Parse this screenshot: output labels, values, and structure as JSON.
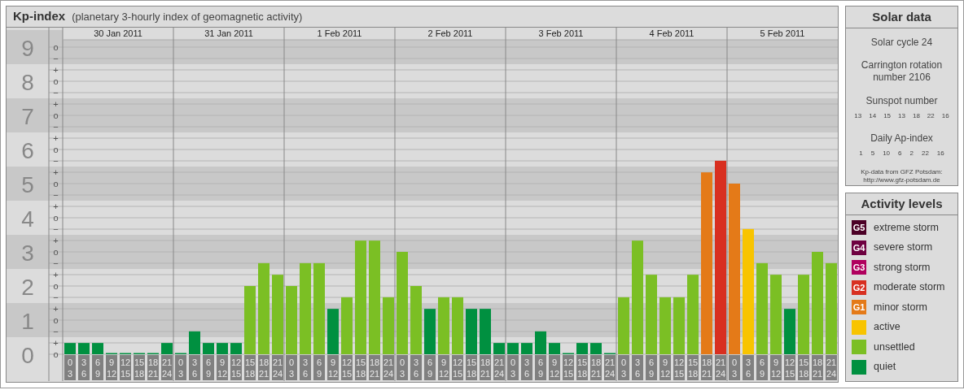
{
  "kp_panel": {
    "title": "Kp-index",
    "subtitle": "(planetary 3-hourly index of geomagnetic activity)",
    "days": [
      "30 Jan 2011",
      "31 Jan 2011",
      "1 Feb 2011",
      "2 Feb 2011",
      "3 Feb 2011",
      "4 Feb 2011",
      "5 Feb 2011"
    ],
    "sublabels": [
      "o",
      "−",
      "+",
      "o",
      "−",
      "+",
      "o",
      "−",
      "+",
      "o",
      "−",
      "+",
      "o",
      "−",
      "+",
      "o",
      "−",
      "+",
      "o",
      "−",
      "+",
      "o",
      "−",
      "+",
      "o",
      "−",
      "+",
      "o"
    ],
    "chart_data": {
      "type": "bar",
      "grid": true,
      "ylim": [
        0,
        9
      ],
      "yticks": [
        0,
        1,
        2,
        3,
        4,
        5,
        6,
        7,
        8,
        9
      ],
      "categories": [
        "0\n3",
        "3\n6",
        "6\n9",
        "9\n12",
        "12\n15",
        "15\n18",
        "18\n21",
        "21\n24",
        "0\n3",
        "3\n6",
        "6\n9",
        "9\n12",
        "12\n15",
        "15\n18",
        "18\n21",
        "21\n24",
        "0\n3",
        "3\n6",
        "6\n9",
        "9\n12",
        "12\n15",
        "15\n18",
        "18\n21",
        "21\n24",
        "0\n3",
        "3\n6",
        "6\n9",
        "9\n12",
        "12\n15",
        "15\n18",
        "18\n21",
        "21\n24",
        "0\n3",
        "3\n6",
        "6\n9",
        "9\n12",
        "12\n15",
        "15\n18",
        "18\n21",
        "21\n24",
        "0\n3",
        "3\n6",
        "6\n9",
        "9\n12",
        "12\n15",
        "15\n18",
        "18\n21",
        "21\n24",
        "0\n3",
        "3\n6",
        "6\n9",
        "9\n12",
        "12\n15",
        "15\n18",
        "18\n21",
        "21\n24"
      ],
      "series": [
        {
          "color": "#009040",
          "values": [
            0.33,
            0.33,
            0.33,
            0,
            0,
            0,
            0,
            0.33,
            0,
            0.67,
            0.33,
            0.33,
            0.33,
            null,
            null,
            null,
            null,
            null,
            null,
            1.33,
            null,
            null,
            null,
            null,
            null,
            null,
            1.33,
            null,
            null,
            1.33,
            1.33,
            0.33,
            0.33,
            0.33,
            0.67,
            0.33,
            0,
            0.33,
            0.33,
            0,
            null,
            null,
            null,
            null,
            null,
            null,
            null,
            null,
            null,
            null,
            null,
            null,
            1.33,
            null,
            null,
            null
          ]
        },
        {
          "color": "#7bbf24",
          "values": [
            null,
            null,
            null,
            null,
            null,
            null,
            null,
            null,
            null,
            null,
            null,
            null,
            null,
            2,
            2.67,
            2.33,
            2,
            2.67,
            2.67,
            null,
            1.67,
            3.33,
            3.33,
            1.67,
            3,
            2,
            null,
            1.67,
            1.67,
            null,
            null,
            null,
            null,
            null,
            null,
            null,
            null,
            null,
            null,
            null,
            1.67,
            3.33,
            2.33,
            1.67,
            1.67,
            2.33,
            null,
            null,
            null,
            null,
            2.67,
            2.33,
            null,
            2.33,
            3,
            2.67
          ]
        },
        {
          "color": "#f8c400",
          "values": [
            null,
            null,
            null,
            null,
            null,
            null,
            null,
            null,
            null,
            null,
            null,
            null,
            null,
            null,
            null,
            null,
            null,
            null,
            null,
            null,
            null,
            null,
            null,
            null,
            null,
            null,
            null,
            null,
            null,
            null,
            null,
            null,
            null,
            null,
            null,
            null,
            null,
            null,
            null,
            null,
            null,
            null,
            null,
            null,
            null,
            null,
            null,
            null,
            null,
            3.67,
            null,
            null,
            null,
            null,
            null,
            null
          ]
        },
        {
          "color": "#e47a18",
          "values": [
            null,
            null,
            null,
            null,
            null,
            null,
            null,
            null,
            null,
            null,
            null,
            null,
            null,
            null,
            null,
            null,
            null,
            null,
            null,
            null,
            null,
            null,
            null,
            null,
            null,
            null,
            null,
            null,
            null,
            null,
            null,
            null,
            null,
            null,
            null,
            null,
            null,
            null,
            null,
            null,
            null,
            null,
            null,
            null,
            null,
            null,
            5.33,
            null,
            5,
            null,
            null,
            null,
            null,
            null,
            null,
            null
          ]
        },
        {
          "color": "#d82f20",
          "values": [
            null,
            null,
            null,
            null,
            null,
            null,
            null,
            null,
            null,
            null,
            null,
            null,
            null,
            null,
            null,
            null,
            null,
            null,
            null,
            null,
            null,
            null,
            null,
            null,
            null,
            null,
            null,
            null,
            null,
            null,
            null,
            null,
            null,
            null,
            null,
            null,
            null,
            null,
            null,
            null,
            null,
            null,
            null,
            null,
            null,
            null,
            null,
            5.67,
            null,
            null,
            null,
            null,
            null,
            null,
            null,
            null
          ]
        }
      ]
    }
  },
  "solar_data": {
    "title": "Solar data",
    "solar_cycle": "Solar cycle 24",
    "carrington": "Carrington rotation number 2106",
    "sunspot_label": "Sunspot number",
    "sunspot_numbers": [
      "13",
      "14",
      "15",
      "13",
      "18",
      "22",
      "16"
    ],
    "ap_label": "Daily Ap-index",
    "ap_values": [
      "1",
      "5",
      "10",
      "6",
      "2",
      "22",
      "16"
    ],
    "source_note": [
      "Kp-data from GFZ Potsdam:",
      "http://www.gfz-potsdam.de"
    ]
  },
  "activity_levels": {
    "title": "Activity levels",
    "items": [
      {
        "badge": "G5",
        "label": "extreme storm",
        "color": "#4b0026"
      },
      {
        "badge": "G4",
        "label": "severe storm",
        "color": "#6e0040"
      },
      {
        "badge": "G3",
        "label": "strong storm",
        "color": "#b0005e"
      },
      {
        "badge": "G2",
        "label": "moderate storm",
        "color": "#d82f20"
      },
      {
        "badge": "G1",
        "label": "minor storm",
        "color": "#e47a18"
      },
      {
        "label": "active",
        "color": "#f8c400"
      },
      {
        "label": "unsettled",
        "color": "#7bbf24"
      },
      {
        "label": "quiet",
        "color": "#009040"
      }
    ]
  }
}
